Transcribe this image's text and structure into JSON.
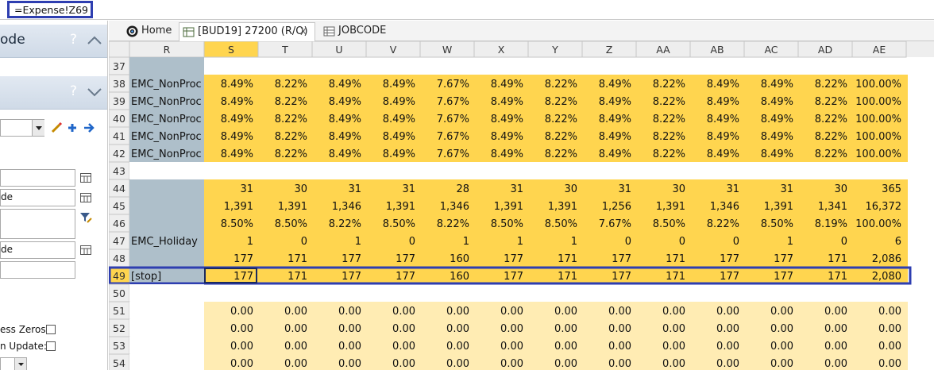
{
  "formula_bar": {
    "value": "=Expense!Z69"
  },
  "left_panel": {
    "header1": {
      "title": "ode",
      "help": "?"
    },
    "header2": {
      "help": "?"
    },
    "field2_value": "de",
    "field4_value": "de",
    "suppress_zeros_label": "ess Zeros:",
    "on_update_label": "n Update:"
  },
  "tabs": [
    {
      "label": "Home",
      "icon": "home-logo-icon"
    },
    {
      "label": "[BUD19] 27200 (R/O)",
      "icon": "worksheet-icon",
      "close": "X"
    },
    {
      "label": "JOBCODE",
      "icon": "table-icon"
    }
  ],
  "grid": {
    "columns": [
      "R",
      "S",
      "T",
      "U",
      "V",
      "W",
      "X",
      "Y",
      "Z",
      "AA",
      "AB",
      "AC",
      "AD",
      "AE"
    ],
    "rows": [
      {
        "num": "37",
        "label": "",
        "style": "blank",
        "cells": []
      },
      {
        "num": "38",
        "label": "EMC_NonProc",
        "style": "gold",
        "cells": [
          "8.49%",
          "8.22%",
          "8.49%",
          "8.49%",
          "7.67%",
          "8.49%",
          "8.22%",
          "8.49%",
          "8.22%",
          "8.49%",
          "8.49%",
          "8.22%",
          "100.00%"
        ]
      },
      {
        "num": "39",
        "label": "EMC_NonProc",
        "style": "gold",
        "cells": [
          "8.49%",
          "8.22%",
          "8.49%",
          "8.49%",
          "7.67%",
          "8.49%",
          "8.22%",
          "8.49%",
          "8.22%",
          "8.49%",
          "8.49%",
          "8.22%",
          "100.00%"
        ]
      },
      {
        "num": "40",
        "label": "EMC_NonProc",
        "style": "gold",
        "cells": [
          "8.49%",
          "8.22%",
          "8.49%",
          "8.49%",
          "7.67%",
          "8.49%",
          "8.22%",
          "8.49%",
          "8.22%",
          "8.49%",
          "8.49%",
          "8.22%",
          "100.00%"
        ]
      },
      {
        "num": "41",
        "label": "EMC_NonProc",
        "style": "gold",
        "cells": [
          "8.49%",
          "8.22%",
          "8.49%",
          "8.49%",
          "7.67%",
          "8.49%",
          "8.22%",
          "8.49%",
          "8.22%",
          "8.49%",
          "8.49%",
          "8.22%",
          "100.00%"
        ]
      },
      {
        "num": "42",
        "label": "EMC_NonProc",
        "style": "gold",
        "cells": [
          "8.49%",
          "8.22%",
          "8.49%",
          "8.49%",
          "7.67%",
          "8.49%",
          "8.22%",
          "8.49%",
          "8.22%",
          "8.49%",
          "8.49%",
          "8.22%",
          "100.00%"
        ]
      },
      {
        "num": "43",
        "label": "",
        "style": "blank",
        "cells": []
      },
      {
        "num": "44",
        "label": "",
        "style": "gold",
        "cells": [
          "31",
          "30",
          "31",
          "31",
          "28",
          "31",
          "30",
          "31",
          "30",
          "31",
          "31",
          "30",
          "365"
        ]
      },
      {
        "num": "45",
        "label": "",
        "style": "gold",
        "cells": [
          "1,391",
          "1,391",
          "1,346",
          "1,391",
          "1,346",
          "1,391",
          "1,391",
          "1,256",
          "1,391",
          "1,346",
          "1,391",
          "1,341",
          "16,372"
        ]
      },
      {
        "num": "46",
        "label": "",
        "style": "gold",
        "cells": [
          "8.50%",
          "8.50%",
          "8.22%",
          "8.50%",
          "8.22%",
          "8.50%",
          "8.50%",
          "7.67%",
          "8.50%",
          "8.22%",
          "8.50%",
          "8.19%",
          "100.00%"
        ]
      },
      {
        "num": "47",
        "label": "EMC_Holiday",
        "style": "gold",
        "cells": [
          "1",
          "0",
          "1",
          "0",
          "1",
          "1",
          "1",
          "0",
          "0",
          "0",
          "1",
          "0",
          "6"
        ]
      },
      {
        "num": "48",
        "label": "",
        "style": "gold",
        "cells": [
          "177",
          "171",
          "177",
          "177",
          "160",
          "177",
          "171",
          "177",
          "171",
          "177",
          "177",
          "171",
          "2,086"
        ]
      },
      {
        "num": "49",
        "label": "[stop]",
        "style": "gold",
        "cells": [
          "177",
          "171",
          "177",
          "177",
          "160",
          "177",
          "171",
          "177",
          "171",
          "177",
          "177",
          "171",
          "2,080"
        ]
      },
      {
        "num": "50",
        "label": "",
        "style": "blank",
        "cells": []
      },
      {
        "num": "51",
        "label": "",
        "style": "pale",
        "cells": [
          "0.00",
          "0.00",
          "0.00",
          "0.00",
          "0.00",
          "0.00",
          "0.00",
          "0.00",
          "0.00",
          "0.00",
          "0.00",
          "0.00",
          "0.00"
        ]
      },
      {
        "num": "52",
        "label": "",
        "style": "pale",
        "cells": [
          "0.00",
          "0.00",
          "0.00",
          "0.00",
          "0.00",
          "0.00",
          "0.00",
          "0.00",
          "0.00",
          "0.00",
          "0.00",
          "0.00",
          "0.00"
        ]
      },
      {
        "num": "53",
        "label": "",
        "style": "pale",
        "cells": [
          "0.00",
          "0.00",
          "0.00",
          "0.00",
          "0.00",
          "0.00",
          "0.00",
          "0.00",
          "0.00",
          "0.00",
          "0.00",
          "0.00",
          "0.00"
        ]
      },
      {
        "num": "54",
        "label": "",
        "style": "pale",
        "cells": [
          "0.00",
          "0.00",
          "0.00",
          "0.00",
          "0.00",
          "0.00",
          "0.00",
          "0.00",
          "0.00",
          "0.00",
          "0.00",
          "0.00",
          "0.00"
        ]
      }
    ],
    "selected_cell": "S49",
    "highlighted_row": "49",
    "colors": {
      "gold": "#ffd54f",
      "pale": "#ffecb3",
      "label_col": "#aebfca",
      "header_bg": "#eeeeee",
      "header_selected": "#ffd54f",
      "highlight_border": "#2e3eb0"
    }
  }
}
